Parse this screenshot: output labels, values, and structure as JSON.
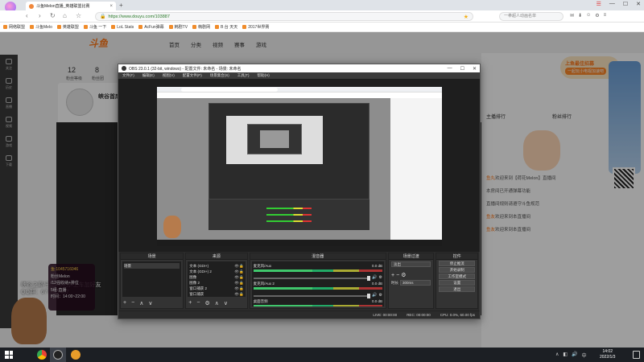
{
  "browser": {
    "badge": "云客服面",
    "tab_title": "斗鱼Melon直播_英雄联盟比赛",
    "new_tab": "+",
    "win_controls": [
      "☰",
      "—",
      "☐",
      "✕"
    ],
    "url": "https://www.douyu.com/103887",
    "search_placeholder": "一拳超人动画名单",
    "bookmarks": [
      "网络联盟",
      "斗鱼Melo",
      "英雄联盟",
      "斗鱼 一下",
      "LoL Stats",
      "AcFun弹幕",
      "韩剧TV",
      "韩剧网",
      "B 台 天天",
      "2017世界赛"
    ]
  },
  "page": {
    "logo": "斗鱼",
    "nav": [
      "首页",
      "分类",
      "视频",
      "赛事",
      "游戏"
    ],
    "level": "12",
    "level_caption": "粉丝等级",
    "fans": "8",
    "fans_caption": "粉丝团",
    "room_name": "峡谷首席",
    "bio_line1": "峡谷之巅/王者800分/上车加好友",
    "bio_line2": "QQ群：677277487",
    "fan_card": [
      "鱼:1045716046",
      "粉丝Melon",
      "/12强收纳+排位",
      "5组·直播",
      "时间：14:00~22:00"
    ],
    "banner_title": "上鱼最佳招募",
    "banner_sub": "一起玩小电视加速吧",
    "rank_left": "主播排行",
    "rank_right": "粉丝排行",
    "chat": [
      {
        "name": "鱼丸",
        "text": "欢迎来到【荷花Melon】直播间"
      },
      {
        "name": "",
        "text": "本房间已开通弹幕功能"
      },
      {
        "name": "",
        "text": "直播间规则请遵守斗鱼规范"
      },
      {
        "name": "鱼友",
        "text": "欢迎来到本直播间"
      },
      {
        "name": "鱼友",
        "text": "欢迎来到本直播间"
      }
    ],
    "sidebar": [
      "关注",
      "历史",
      "直播",
      "视频",
      "游戏",
      "下载"
    ]
  },
  "obs": {
    "title": "OBS 23.0.1 (32-bit, windows) - 配置文件: 未命名 - 场景: 未命名",
    "menu": [
      "文件(F)",
      "编辑(E)",
      "视图(V)",
      "配置文件(P)",
      "场景集合(S)",
      "工具(T)",
      "帮助(H)"
    ],
    "docks": {
      "scenes": {
        "title": "场景",
        "items": [
          "场景"
        ]
      },
      "sources": {
        "title": "来源",
        "items": [
          "文本 (GDI+)",
          "文本 (GDI+) 2",
          "图像",
          "图像 2",
          "窗口捕获 2",
          "窗口捕获"
        ]
      },
      "mixer": {
        "title": "混音器",
        "channels": [
          {
            "name": "麦克风/Aux",
            "db": "0.0 dB"
          },
          {
            "name": "麦克风/Aux 2",
            "db": "0.0 dB"
          },
          {
            "name": "桌面音频",
            "db": "0.0 dB"
          }
        ]
      },
      "transitions": {
        "title": "场景过渡",
        "selected": "淡出",
        "duration_label": "时长",
        "duration": "300ms"
      },
      "controls": {
        "title": "控件",
        "buttons": [
          "停止推流",
          "开始录制",
          "工作室模式",
          "设置",
          "退出"
        ]
      }
    },
    "status": [
      "LIVE: 00:00:00",
      "REC: 00:00:00",
      "CPU: 0.0%, 60.00 fps"
    ]
  },
  "taskbar": {
    "time": "14:02",
    "date": "2022/1/3"
  }
}
